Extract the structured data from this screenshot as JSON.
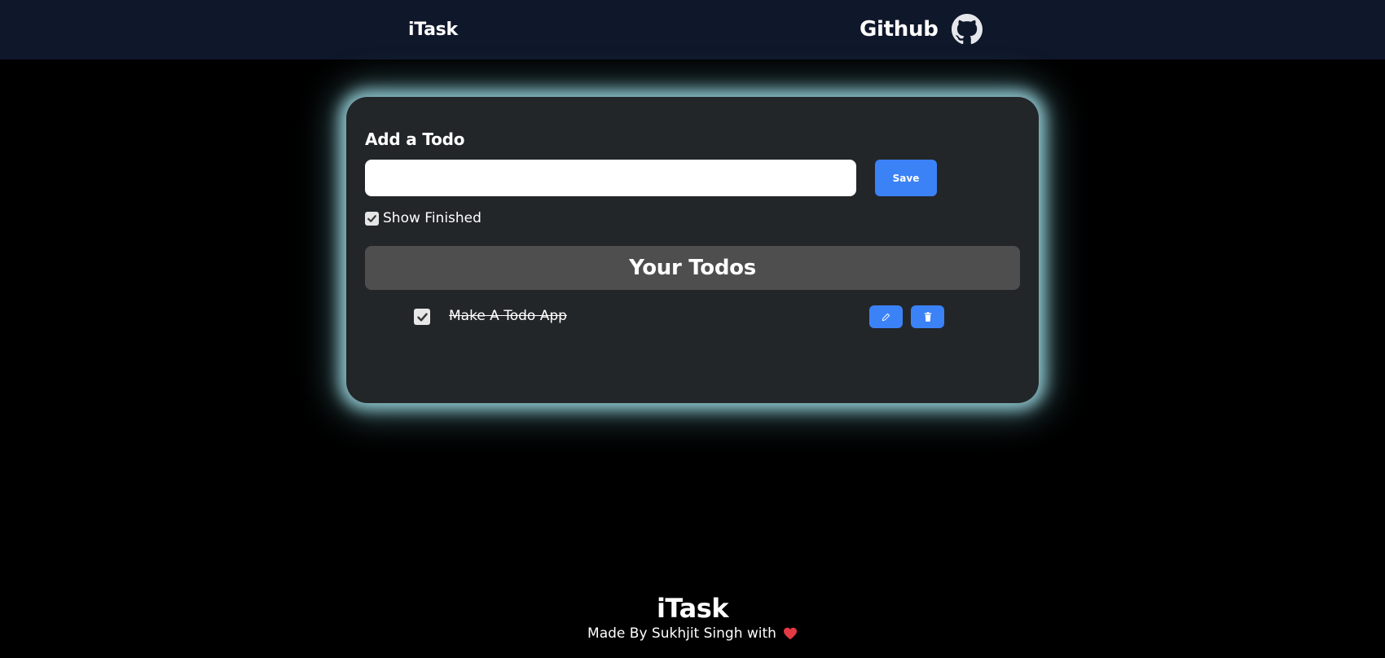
{
  "navbar": {
    "brand": "iTask",
    "github_label": "Github",
    "github_icon": "github-icon"
  },
  "form": {
    "title": "Add a Todo",
    "input_value": "",
    "input_placeholder": "",
    "save_label": "Save",
    "show_finished_label": "Show Finished",
    "show_finished_checked": true
  },
  "todos": {
    "header": "Your Todos",
    "items": [
      {
        "text": "Make A Todo App",
        "completed": true,
        "edit_icon": "pencil-icon",
        "delete_icon": "trash-icon"
      }
    ]
  },
  "footer": {
    "brand": "iTask",
    "credit": "Made By Sukhjit Singh with",
    "heart_icon": "heart-icon"
  },
  "colors": {
    "navbar_bg": "#0f172a",
    "card_bg": "#232628",
    "accent": "#3b82f6",
    "glow": "#a0dce4",
    "heart": "#e53945"
  }
}
